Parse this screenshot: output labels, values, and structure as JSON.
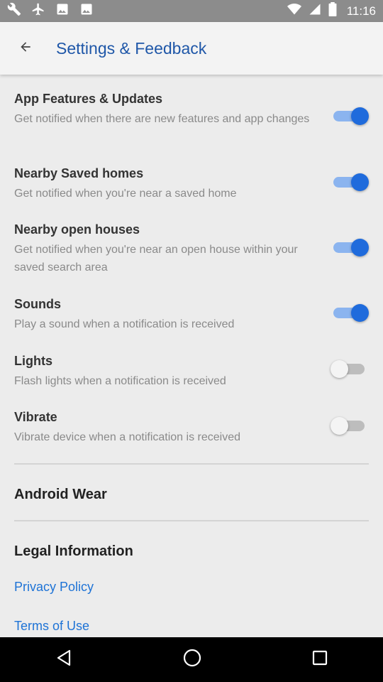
{
  "status_bar": {
    "time": "11:16",
    "left_icons": [
      "wrench-icon",
      "airplane-icon",
      "image-icon",
      "image-icon"
    ],
    "right_icons": [
      "wifi-icon",
      "signal-icon",
      "battery-icon"
    ]
  },
  "app_bar": {
    "title": "Settings & Feedback",
    "back_icon": "back-arrow-icon"
  },
  "settings": [
    {
      "title": "App Features & Updates",
      "desc": "Get notified when there are new features and app changes",
      "on": true
    },
    {
      "title": "Nearby Saved homes",
      "desc": "Get notified when you're near a saved home",
      "on": true
    },
    {
      "title": "Nearby open houses",
      "desc": "Get notified when you're near an open house within your saved search area",
      "on": true
    },
    {
      "title": "Sounds",
      "desc": "Play a sound when a notification is received",
      "on": true
    },
    {
      "title": "Lights",
      "desc": "Flash lights when a notification is received",
      "on": false
    },
    {
      "title": "Vibrate",
      "desc": "Vibrate device when a notification is received",
      "on": false
    }
  ],
  "sections": {
    "android_wear": "Android Wear",
    "legal": "Legal Information"
  },
  "links": {
    "privacy": "Privacy Policy",
    "terms": "Terms of Use"
  },
  "colors": {
    "accent": "#1f6bdc",
    "title": "#1f57a8",
    "link": "#1e73d6"
  },
  "nav_bar": [
    "back-triangle-icon",
    "home-circle-icon",
    "recents-square-icon"
  ]
}
